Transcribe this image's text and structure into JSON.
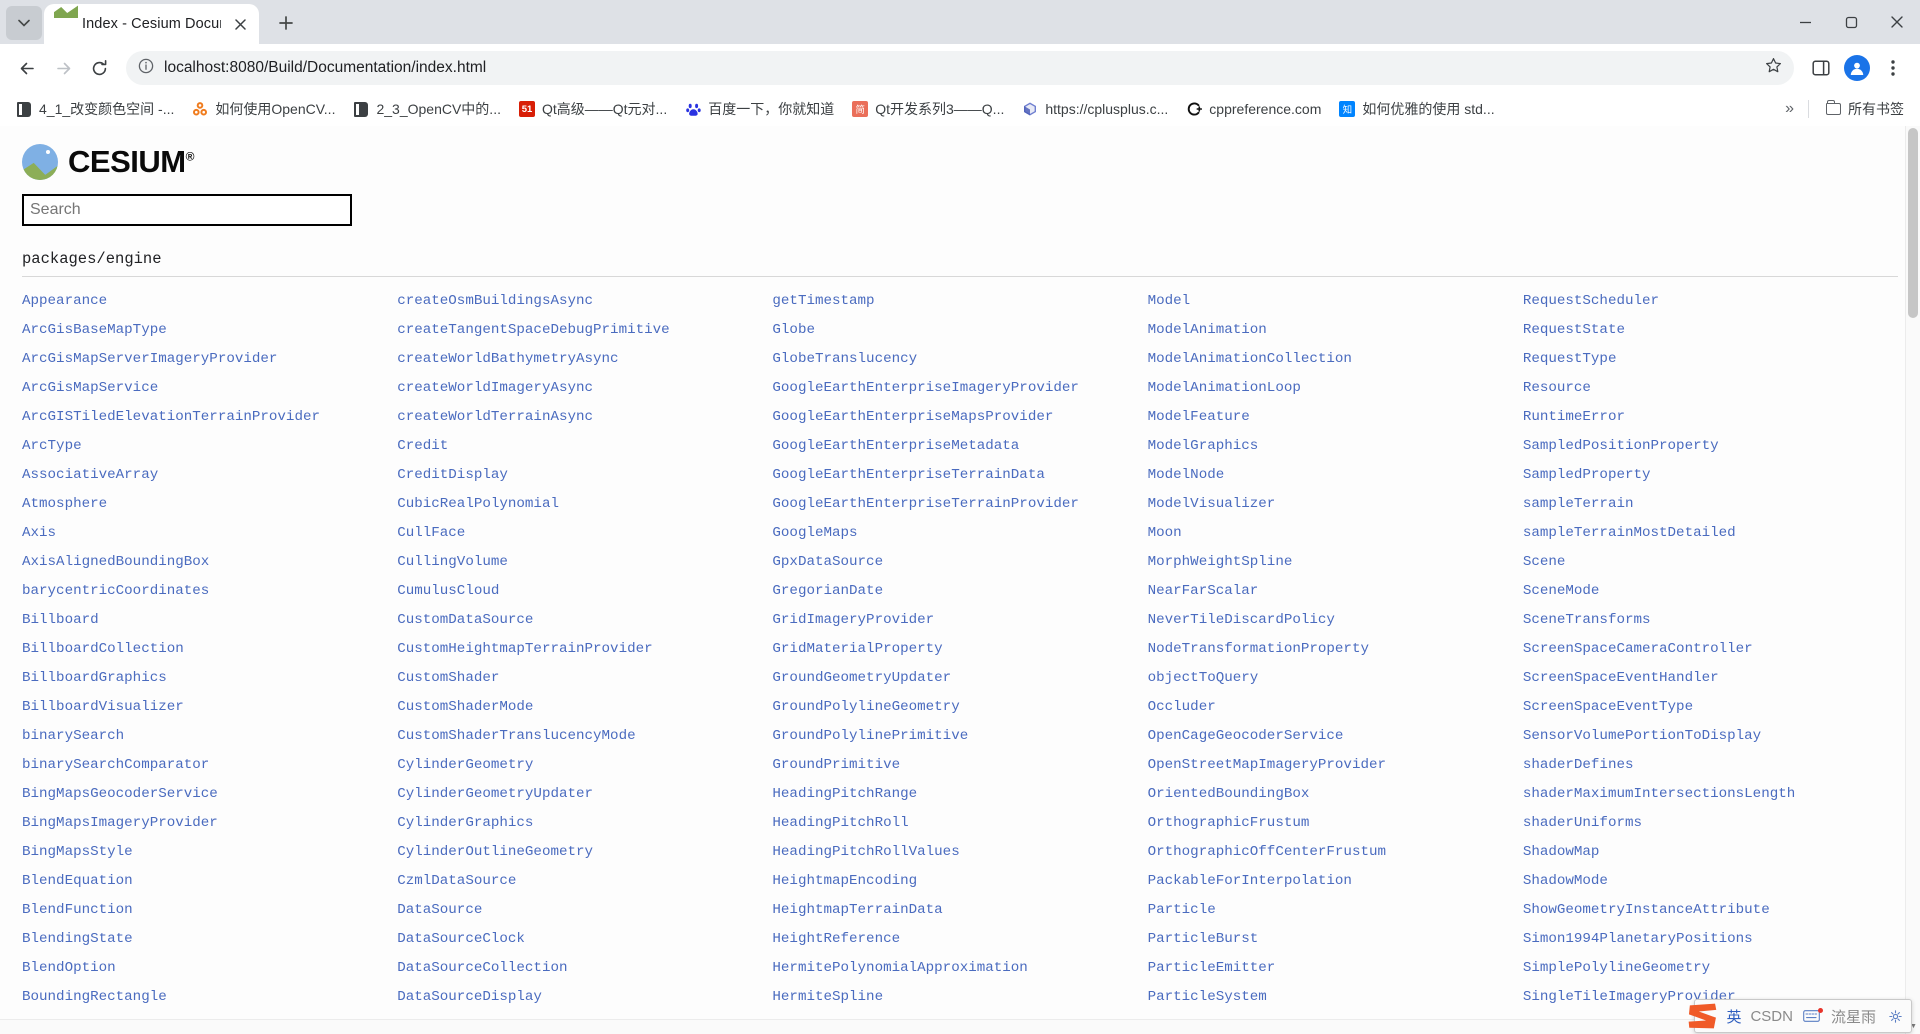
{
  "window": {
    "tab": {
      "title": "Index - Cesium Documentatio",
      "favicon_name": "cesium-favicon"
    },
    "new_tab_label": "+",
    "controls": {
      "minimize": "minimize-icon",
      "maximize": "maximize-icon",
      "close": "close-icon"
    }
  },
  "toolbar": {
    "back": "back-arrow-icon",
    "forward": "forward-arrow-icon",
    "reload": "reload-icon",
    "site_info": "site-info-icon",
    "url": "localhost:8080/Build/Documentation/index.html",
    "bookmark_star": "star-icon",
    "side_panel": "side-panel-icon",
    "profile": "profile-avatar",
    "menu": "three-dot-menu-icon"
  },
  "bookmarks": {
    "items": [
      {
        "label": "4_1_改变颜色空间 -...",
        "icon": "book-icon",
        "icon_kind": "book"
      },
      {
        "label": "如何使用OpenCV...",
        "icon": "opencv-icon",
        "icon_kind": "round",
        "color": "#f07c1e",
        "glyph": "◉"
      },
      {
        "label": "2_3_OpenCV中的...",
        "icon": "book-icon",
        "icon_kind": "book"
      },
      {
        "label": "Qt高级——Qt元对...",
        "icon": "51cto-icon",
        "icon_kind": "square",
        "color": "#d81e06",
        "glyph": "51"
      },
      {
        "label": "百度一下，你就知道",
        "icon": "baidu-icon",
        "icon_kind": "paw",
        "color": "#2932e1",
        "glyph": "熊"
      },
      {
        "label": "Qt开发系列3——Q...",
        "icon": "jianshu-icon",
        "icon_kind": "square",
        "color": "#ea6f5a",
        "glyph": "简"
      },
      {
        "label": "https://cplusplus.c...",
        "icon": "cplusplus-icon",
        "icon_kind": "round",
        "color": "#6f7fd0",
        "glyph": "C"
      },
      {
        "label": "cppreference.com",
        "icon": "cppreference-icon",
        "icon_kind": "cpp",
        "color": "#000000",
        "glyph": "C"
      },
      {
        "label": "如何优雅的使用 std...",
        "icon": "zhihu-icon",
        "icon_kind": "square",
        "color": "#0084ff",
        "glyph": "知"
      }
    ],
    "overflow_label": "»",
    "all_bookmarks_label": "所有书签",
    "all_bookmarks_icon": "folder-icon"
  },
  "page": {
    "brand": {
      "name": "CESIUM",
      "trademark": "®",
      "logo_icon": "cesium-logo-icon"
    },
    "search": {
      "value": "",
      "placeholder": "Search"
    },
    "section_title": "packages/engine",
    "columns": [
      [
        "Appearance",
        "ArcGisBaseMapType",
        "ArcGisMapServerImageryProvider",
        "ArcGisMapService",
        "ArcGISTiledElevationTerrainProvider",
        "ArcType",
        "AssociativeArray",
        "Atmosphere",
        "Axis",
        "AxisAlignedBoundingBox",
        "barycentricCoordinates",
        "Billboard",
        "BillboardCollection",
        "BillboardGraphics",
        "BillboardVisualizer",
        "binarySearch",
        "binarySearchComparator",
        "BingMapsGeocoderService",
        "BingMapsImageryProvider",
        "BingMapsStyle",
        "BlendEquation",
        "BlendFunction",
        "BlendingState",
        "BlendOption",
        "BoundingRectangle"
      ],
      [
        "createOsmBuildingsAsync",
        "createTangentSpaceDebugPrimitive",
        "createWorldBathymetryAsync",
        "createWorldImageryAsync",
        "createWorldTerrainAsync",
        "Credit",
        "CreditDisplay",
        "CubicRealPolynomial",
        "CullFace",
        "CullingVolume",
        "CumulusCloud",
        "CustomDataSource",
        "CustomHeightmapTerrainProvider",
        "CustomShader",
        "CustomShaderMode",
        "CustomShaderTranslucencyMode",
        "CylinderGeometry",
        "CylinderGeometryUpdater",
        "CylinderGraphics",
        "CylinderOutlineGeometry",
        "CzmlDataSource",
        "DataSource",
        "DataSourceClock",
        "DataSourceCollection",
        "DataSourceDisplay"
      ],
      [
        "getTimestamp",
        "Globe",
        "GlobeTranslucency",
        "GoogleEarthEnterpriseImageryProvider",
        "GoogleEarthEnterpriseMapsProvider",
        "GoogleEarthEnterpriseMetadata",
        "GoogleEarthEnterpriseTerrainData",
        "GoogleEarthEnterpriseTerrainProvider",
        "GoogleMaps",
        "GpxDataSource",
        "GregorianDate",
        "GridImageryProvider",
        "GridMaterialProperty",
        "GroundGeometryUpdater",
        "GroundPolylineGeometry",
        "GroundPolylinePrimitive",
        "GroundPrimitive",
        "HeadingPitchRange",
        "HeadingPitchRoll",
        "HeadingPitchRollValues",
        "HeightmapEncoding",
        "HeightmapTerrainData",
        "HeightReference",
        "HermitePolynomialApproximation",
        "HermiteSpline"
      ],
      [
        "Model",
        "ModelAnimation",
        "ModelAnimationCollection",
        "ModelAnimationLoop",
        "ModelFeature",
        "ModelGraphics",
        "ModelNode",
        "ModelVisualizer",
        "Moon",
        "MorphWeightSpline",
        "NearFarScalar",
        "NeverTileDiscardPolicy",
        "NodeTransformationProperty",
        "objectToQuery",
        "Occluder",
        "OpenCageGeocoderService",
        "OpenStreetMapImageryProvider",
        "OrientedBoundingBox",
        "OrthographicFrustum",
        "OrthographicOffCenterFrustum",
        "PackableForInterpolation",
        "Particle",
        "ParticleBurst",
        "ParticleEmitter",
        "ParticleSystem"
      ],
      [
        "RequestScheduler",
        "RequestState",
        "RequestType",
        "Resource",
        "RuntimeError",
        "SampledPositionProperty",
        "SampledProperty",
        "sampleTerrain",
        "sampleTerrainMostDetailed",
        "Scene",
        "SceneMode",
        "SceneTransforms",
        "ScreenSpaceCameraController",
        "ScreenSpaceEventHandler",
        "ScreenSpaceEventType",
        "SensorVolumePortionToDisplay",
        "shaderDefines",
        "shaderMaximumIntersectionsLength",
        "shaderUniforms",
        "ShadowMap",
        "ShadowMode",
        "ShowGeometryInstanceAttribute",
        "Simon1994PlanetaryPositions",
        "SimplePolylineGeometry",
        "SingleTileImageryProvider"
      ]
    ]
  },
  "ime": {
    "logo_icon": "sogou-logo-icon",
    "mode_label": "英",
    "skin_label": "CSDN",
    "extra_label": "流星雨",
    "menu_icon": "ime-menu-icon",
    "accent": "#f05a28"
  },
  "colors": {
    "link": "#4a6bbf",
    "chrome_frame": "#dee1e6",
    "accent_blue": "#1a73e8"
  }
}
